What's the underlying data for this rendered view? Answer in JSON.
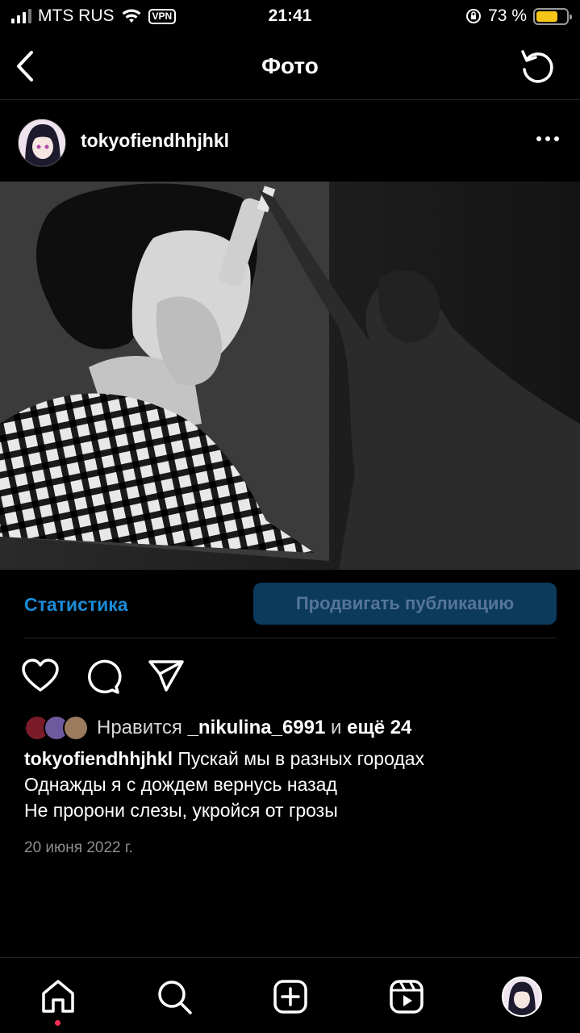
{
  "status_bar": {
    "carrier": "MTS RUS",
    "vpn": "VPN",
    "time": "21:41",
    "battery_percent": "73 %",
    "battery_level": 0.73
  },
  "header": {
    "title": "Фото",
    "back_icon": "chevron-left-icon",
    "refresh_icon": "refresh-icon"
  },
  "post": {
    "username": "tokyofiendhhjhkl",
    "more_icon": "more-horizontal-icon"
  },
  "promo": {
    "stats_label": "Статистика",
    "promote_label": "Продвигать публикацию"
  },
  "actions": {
    "like_icon": "heart-icon",
    "comment_icon": "comment-icon",
    "share_icon": "send-icon"
  },
  "likes": {
    "prefix": "Нравится",
    "user": "_nikulina_6991",
    "middle": "и",
    "more": "ещё 24"
  },
  "caption": {
    "username": "tokyofiendhhjhkl",
    "line1": "Пускай мы в разных городах",
    "line2": "Однажды я с дождем вернусь назад",
    "line3": "Не пророни слезы, укройся от грозы"
  },
  "date": "20 июня 2022 г.",
  "nav": {
    "items": [
      "home-icon",
      "search-icon",
      "add-post-icon",
      "reels-icon",
      "profile-avatar"
    ]
  },
  "colors": {
    "background": "#000000",
    "accent": "#1a8cd8",
    "promote_bg": "#0b3a5c",
    "muted": "#8e8e8e",
    "notification": "#ff2d55"
  }
}
